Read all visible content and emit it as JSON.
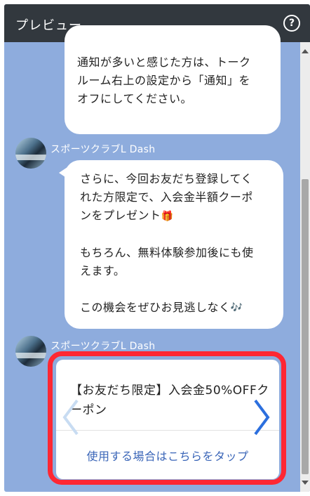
{
  "window": {
    "title": "プレビュー",
    "help_icon": "help-circle-icon"
  },
  "colors": {
    "background": "#8eacdd",
    "titlebar": "#32383e",
    "highlight": "#ff2733",
    "link": "#3b66b8"
  },
  "messages": [
    {
      "text": [
        "通知が多いと感じた方は、トーク",
        "ルーム右上の設定から「通知」を",
        "オフにしてください。"
      ]
    },
    {
      "sender": "スポーツクラブL Dash",
      "paragraphs": [
        {
          "lines": [
            "さらに、今回お友だち登録してく",
            "れた方限定で、入会金半額クーポ",
            "ンをプレゼント"
          ],
          "icon": "🎁"
        },
        {
          "lines": [
            "もちろん、無料体験参加後にも使",
            "えます。"
          ]
        },
        {
          "lines": [
            "この機会をぜひお見逃しなく"
          ],
          "icon": "🎶"
        }
      ]
    }
  ],
  "card_message": {
    "sender": "スポーツクラブL Dash",
    "title": "【お友だち限定】入会金50%OFFクーポン",
    "action": "使用する場合はこちらをタップ"
  }
}
